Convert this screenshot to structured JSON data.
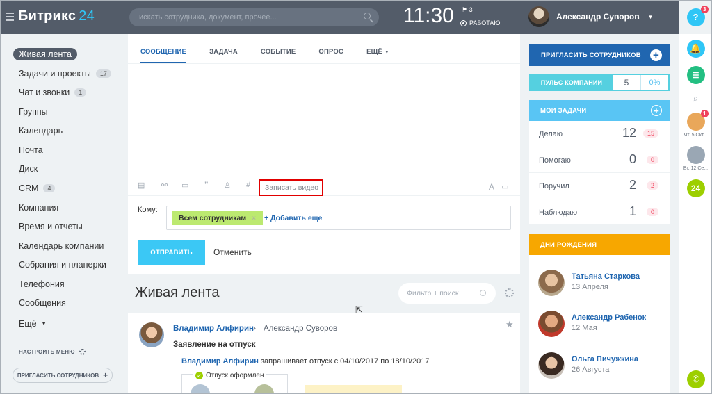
{
  "header": {
    "logo_text": "Битрикс",
    "logo_num": "24",
    "search_placeholder": "искать сотрудника, документ, прочее...",
    "time": "11:30",
    "flag_count": "3",
    "work_status": "РАБОТАЮ",
    "user_name": "Александр Суворов"
  },
  "sidebar": {
    "items": [
      {
        "label": "Живая лента"
      },
      {
        "label": "Задачи и проекты",
        "badge": "17"
      },
      {
        "label": "Чат и звонки",
        "badge": "1"
      },
      {
        "label": "Группы"
      },
      {
        "label": "Календарь"
      },
      {
        "label": "Почта"
      },
      {
        "label": "Диск"
      },
      {
        "label": "CRM",
        "badge": "4"
      },
      {
        "label": "Компания"
      },
      {
        "label": "Время и отчеты"
      },
      {
        "label": "Календарь компании"
      },
      {
        "label": "Собрания и планерки"
      },
      {
        "label": "Телефония"
      },
      {
        "label": "Сообщения"
      },
      {
        "label": "Ещё"
      }
    ],
    "configure_menu": "НАСТРОИТЬ МЕНЮ",
    "invite": "ПРИГЛАСИТЬ СОТРУДНИКОВ"
  },
  "composer": {
    "tabs": [
      "СООБЩЕНИЕ",
      "ЗАДАЧА",
      "СОБЫТИЕ",
      "ОПРОС",
      "ЕЩЁ"
    ],
    "record_video": "Записать видео",
    "to_label": "Кому:",
    "recipient": "Всем сотрудникам",
    "add_more": "+ Добавить еще",
    "send": "ОТПРАВИТЬ",
    "cancel": "Отменить"
  },
  "feed": {
    "title": "Живая лента",
    "filter_placeholder": "Фильтр + поиск",
    "post": {
      "author": "Владимир Алфирин",
      "recipient": "Александр Суворов",
      "title": "Заявление на отпуск",
      "line_author": "Владимир Алфирин",
      "line_text": "запрашивает отпуск с 04/10/2017 по 18/10/2017",
      "status": "Отпуск оформлен"
    }
  },
  "right": {
    "invite": "ПРИГЛАСИТЬ СОТРУДНИКОВ",
    "pulse_label": "ПУЛЬС КОМПАНИИ",
    "pulse_value": "5",
    "pulse_percent": "0%",
    "tasks_title": "МОИ ЗАДАЧИ",
    "tasks": [
      {
        "label": "Делаю",
        "count": "12",
        "badge": "15"
      },
      {
        "label": "Помогаю",
        "count": "0",
        "badge": "0"
      },
      {
        "label": "Поручил",
        "count": "2",
        "badge": "2"
      },
      {
        "label": "Наблюдаю",
        "count": "1",
        "badge": "0"
      }
    ],
    "birthdays_title": "ДНИ РОЖДЕНИЯ",
    "birthdays": [
      {
        "name": "Татьяна Старкова",
        "date": "13 Апреля"
      },
      {
        "name": "Александр Рабенок",
        "date": "12 Мая"
      },
      {
        "name": "Ольга Пичужкина",
        "date": "26 Августа"
      }
    ]
  },
  "strip": {
    "help": "?",
    "help_badge": "3",
    "user_badge": "1",
    "date1": "Чт. 5 Окт...",
    "date2": "Вт. 12 Се...",
    "logo24": "24"
  }
}
